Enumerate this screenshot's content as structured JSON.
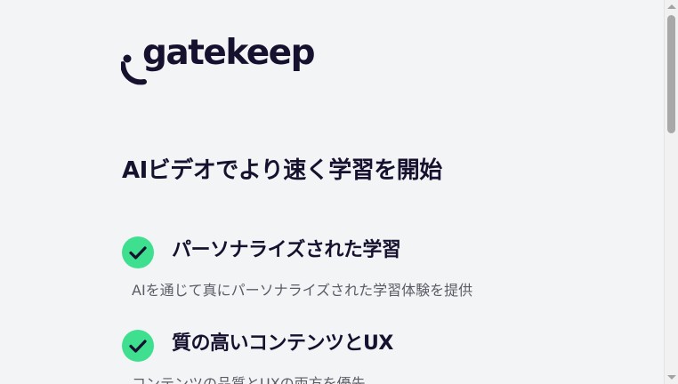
{
  "brand": {
    "logo_text": "gatekeep",
    "logo_color": "#16112e"
  },
  "hero": {
    "headline": "AIビデオでより速く学習を開始"
  },
  "features": [
    {
      "title": "パーソナライズされた学習",
      "description": "AIを通じて真にパーソナライズされた学習体験を提供",
      "icon": "check-circle-icon"
    },
    {
      "title": "質の高いコンテンツとUX",
      "description": "コンテンツの品質とUXの両方を優先",
      "icon": "check-circle-icon"
    }
  ],
  "colors": {
    "background": "#f3f4f6",
    "accent_green": "#3ee08f",
    "text_dark": "#16112e",
    "text_muted": "#5b5b66"
  }
}
